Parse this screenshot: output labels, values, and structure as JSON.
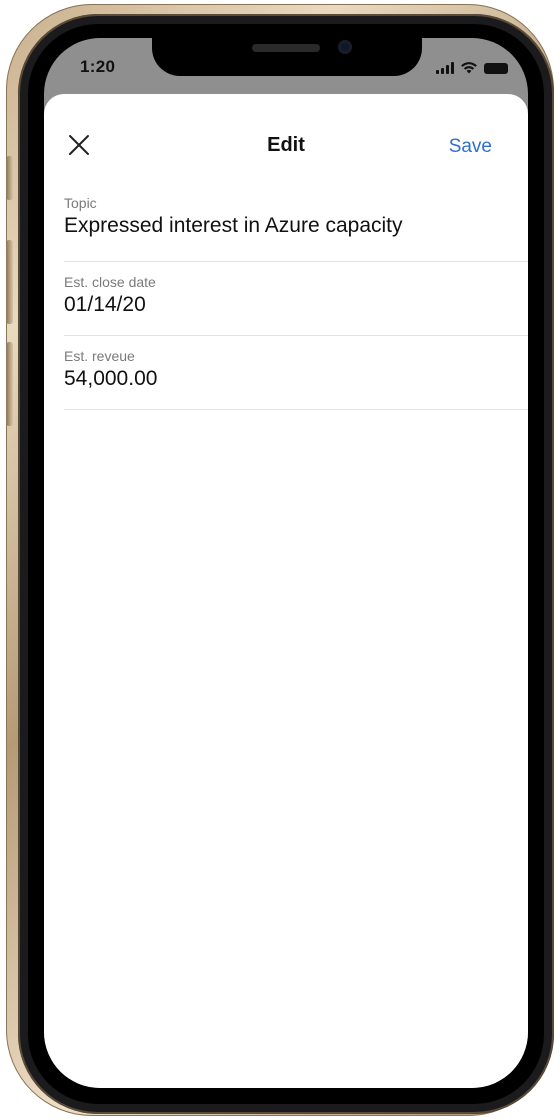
{
  "status_bar": {
    "time": "1:20",
    "icons": [
      "cellular-signal-icon",
      "wifi-icon",
      "battery-icon"
    ]
  },
  "header": {
    "close_icon": "close-icon",
    "title": "Edit",
    "save_label": "Save"
  },
  "fields": [
    {
      "label": "Topic",
      "value": "Expressed interest in Azure capacity"
    },
    {
      "label": "Est. close date",
      "value": "01/14/20"
    },
    {
      "label": "Est. reveue",
      "value": "54,000.00"
    }
  ],
  "colors": {
    "accent": "#2f6fd2",
    "label": "#7a7a7a",
    "text": "#111111",
    "divider": "#e3e3e3"
  }
}
